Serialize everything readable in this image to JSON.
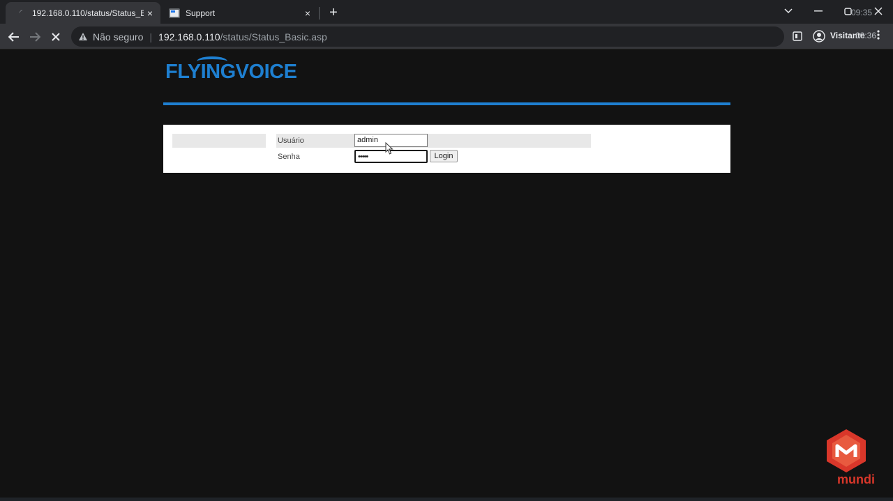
{
  "browser": {
    "tabs": [
      {
        "title": "192.168.0.110/status/Status_Basic.asp",
        "active": true
      },
      {
        "title": "Support",
        "active": false
      }
    ],
    "close_glyph": "×",
    "new_tab_glyph": "+",
    "clock_top": "09:35",
    "omnibox": {
      "security_label": "Não seguro",
      "host": "192.168.0.110",
      "path": "/status/Status_Basic.asp"
    },
    "profile_label": "Visitante",
    "clock_toolbar": "00:36"
  },
  "page": {
    "logo_text": "FLYINGVOICE",
    "login": {
      "username_label": "Usuário",
      "username_value": "admin",
      "password_label": "Senha",
      "password_value": "•••••",
      "login_button": "Login"
    }
  },
  "watermark": {
    "text": "mundi"
  },
  "colors": {
    "brand_blue": "#1e7fd0",
    "watermark_red": "#d9372a"
  }
}
